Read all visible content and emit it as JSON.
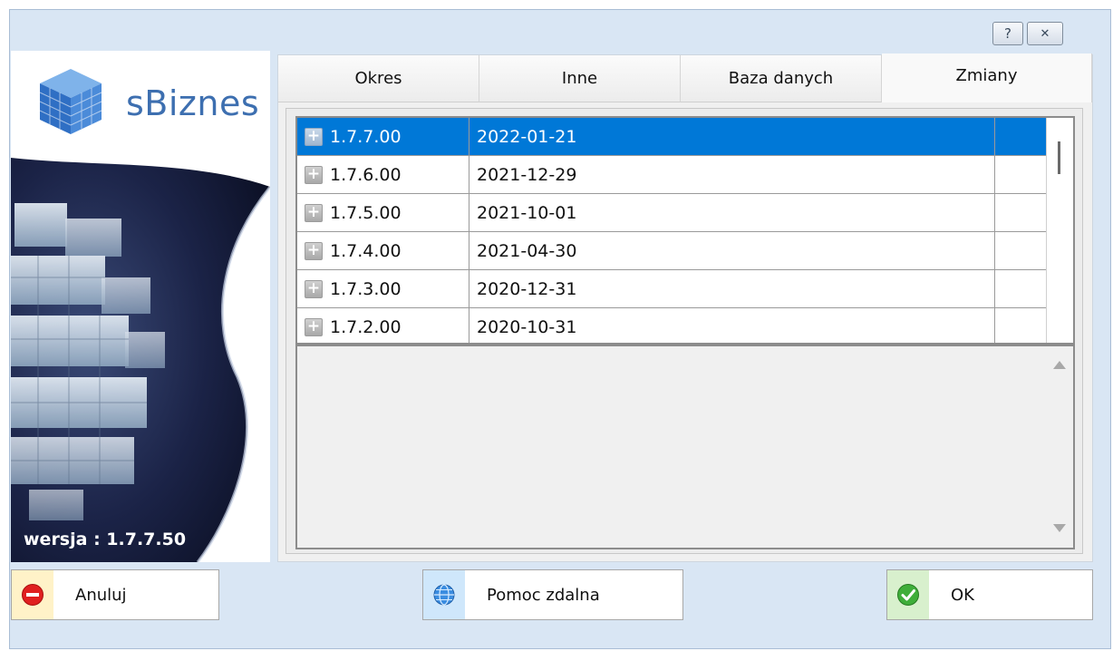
{
  "window": {
    "help_label": "?",
    "close_label": "✕"
  },
  "brand": {
    "name": "sBiznes",
    "version_text": "wersja : 1.7.7.50"
  },
  "tabs": [
    {
      "label": "Okres",
      "active": false
    },
    {
      "label": "Inne",
      "active": false
    },
    {
      "label": "Baza danych",
      "active": false
    },
    {
      "label": "Zmiany",
      "active": true
    }
  ],
  "changes": {
    "rows": [
      {
        "version": "1.7.7.00",
        "date": "2022-01-21",
        "selected": true
      },
      {
        "version": "1.7.6.00",
        "date": "2021-12-29",
        "selected": false
      },
      {
        "version": "1.7.5.00",
        "date": "2021-10-01",
        "selected": false
      },
      {
        "version": "1.7.4.00",
        "date": "2021-04-30",
        "selected": false
      },
      {
        "version": "1.7.3.00",
        "date": "2020-12-31",
        "selected": false
      },
      {
        "version": "1.7.2.00",
        "date": "2020-10-31",
        "selected": false
      }
    ]
  },
  "buttons": {
    "cancel": "Anuluj",
    "remote_help": "Pomoc zdalna",
    "ok": "OK"
  },
  "colors": {
    "selection": "#0078d7",
    "window_bg": "#d9e6f4",
    "brand_text": "#3d6fb0"
  }
}
